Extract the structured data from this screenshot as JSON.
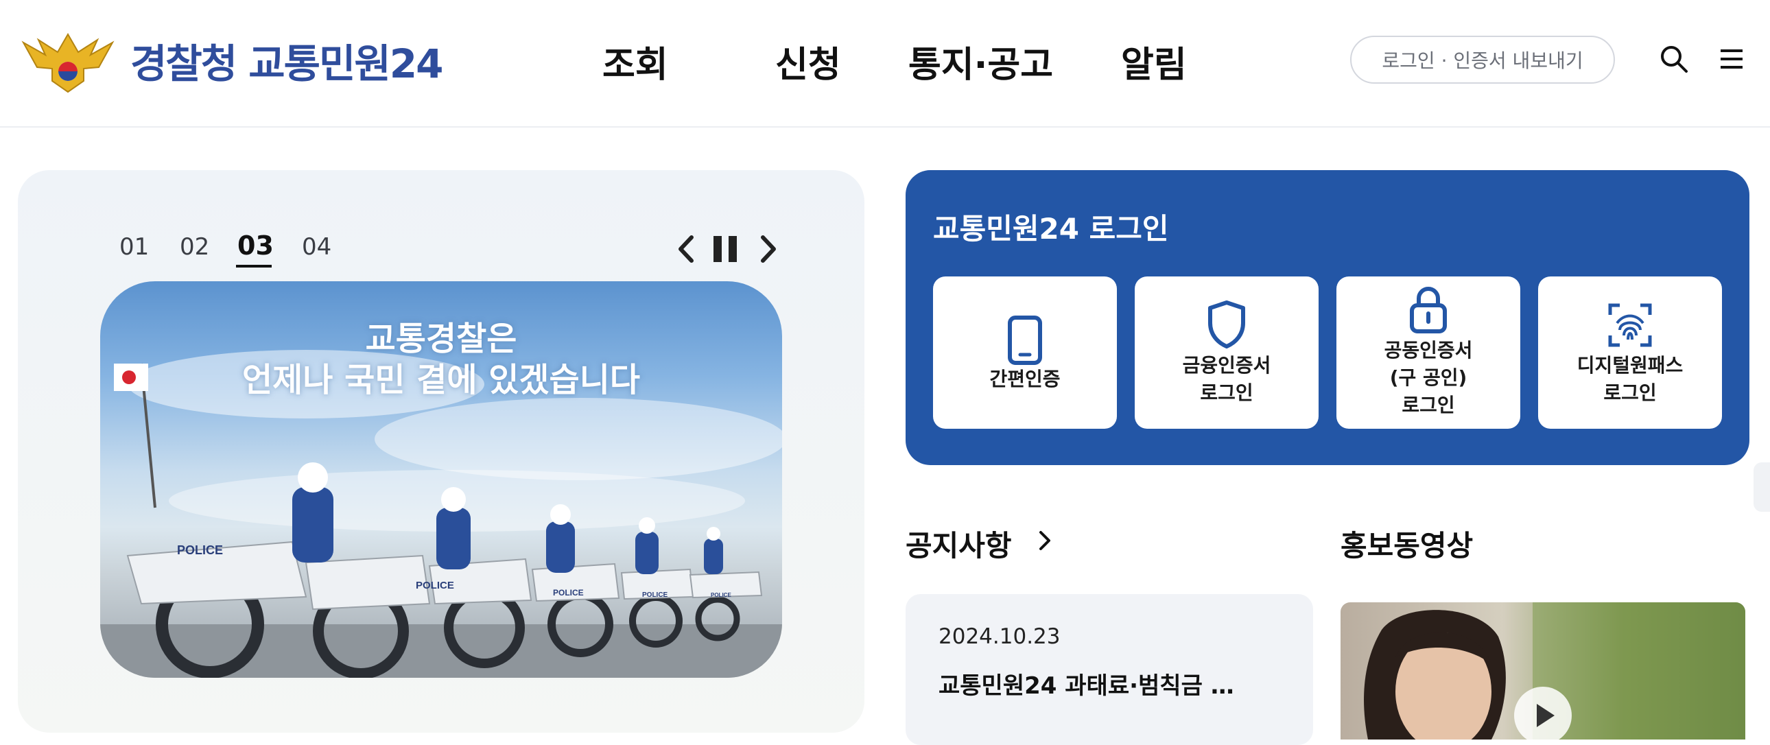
{
  "header": {
    "logo_text": "경찰청 교통민원24",
    "nav": [
      "조회",
      "신청",
      "통지·공고",
      "알림"
    ],
    "login_button": "로그인 · 인증서 내보내기",
    "search_icon": "search-icon",
    "menu_icon": "hamburger-menu-icon"
  },
  "banner": {
    "slides": [
      "01",
      "02",
      "03",
      "04"
    ],
    "active_slide": "03",
    "caption_line1": "교통경찰은",
    "caption_line2": "언제나 국민 곁에 있겠습니다",
    "photo_signs": [
      "POLICE",
      "POLICE",
      "POLICE",
      "POLICE",
      "POLICE"
    ]
  },
  "login": {
    "title": "교통민원24 로그인",
    "methods": [
      {
        "label": "간편인증",
        "icon": "smartphone-icon"
      },
      {
        "label": "금융인증서\n로그인",
        "icon": "shield-icon"
      },
      {
        "label": "공동인증서\n(구 공인)\n로그인",
        "icon": "lock-icon"
      },
      {
        "label": "디지털원패스\n로그인",
        "icon": "fingerprint-icon"
      }
    ]
  },
  "notice": {
    "title": "공지사항",
    "date": "2024.10.23",
    "text": "교통민원24 과태료·범칙금 …"
  },
  "video": {
    "title": "홍보동영상"
  },
  "colors": {
    "brand_blue": "#2356a6",
    "logo_blue": "#2f4d9c"
  }
}
